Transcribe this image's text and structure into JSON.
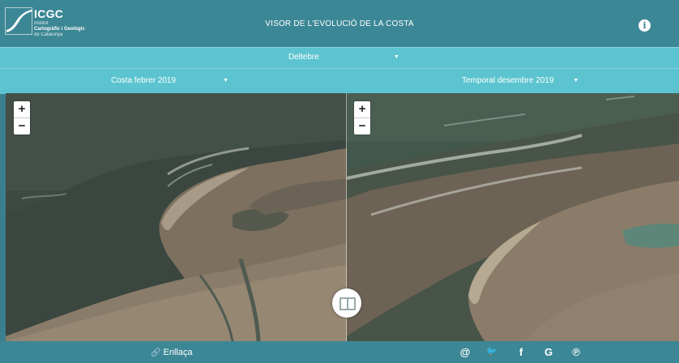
{
  "header": {
    "logo_acronym": "ICGC",
    "logo_line1": "Institut",
    "logo_line2": "Cartogràfic i Geològic",
    "logo_line3": "de Catalunya",
    "title": "VISOR DE L'EVOLUCIÓ DE LA COSTA",
    "info_icon": "i"
  },
  "location_select": {
    "value": "Deltebre"
  },
  "left_select": {
    "value": "Costa febrer 2019"
  },
  "right_select": {
    "value": "Temporal desembre 2019"
  },
  "zoom": {
    "in_label": "+",
    "out_label": "−"
  },
  "footer": {
    "link_label": "Enllaça",
    "link_icon": "🔗",
    "share_icons": [
      {
        "name": "email-icon",
        "glyph": "@"
      },
      {
        "name": "twitter-icon",
        "glyph": "🐦"
      },
      {
        "name": "facebook-icon",
        "glyph": "f"
      },
      {
        "name": "google-icon",
        "glyph": "G"
      },
      {
        "name": "pinterest-icon",
        "glyph": "℗"
      }
    ]
  },
  "colors": {
    "header": "#3c8795",
    "bars": "#5cc4d0",
    "sea": "#3f4e46",
    "sand": "#8a7c6a"
  }
}
